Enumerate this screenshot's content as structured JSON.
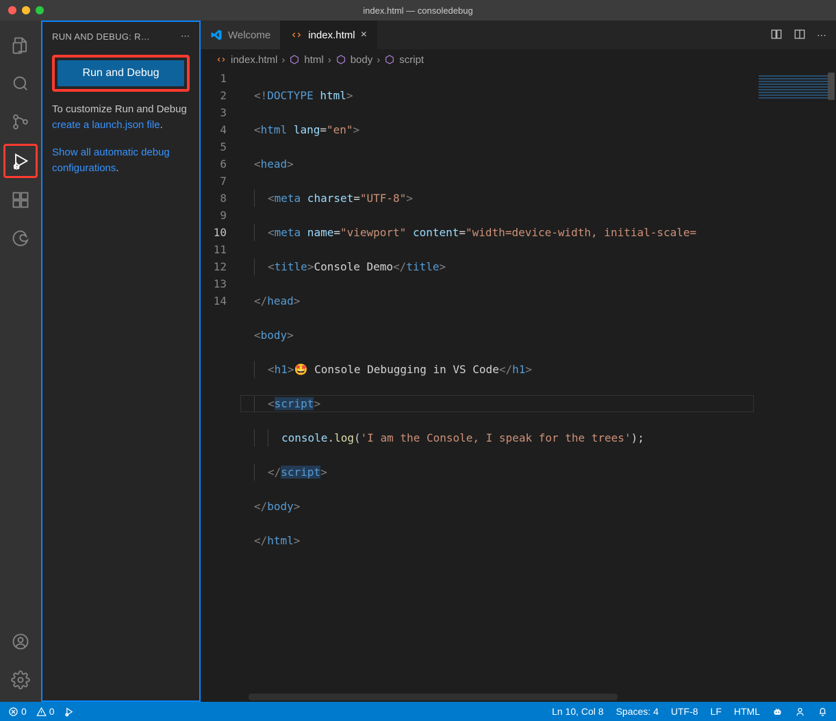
{
  "window": {
    "title": "index.html — consoledebug"
  },
  "sidebar": {
    "header": "RUN AND DEBUG: R…",
    "run_button": "Run and Debug",
    "customize_pre": "To customize Run and Debug ",
    "customize_link": "create a launch.json file",
    "customize_post": ".",
    "show_link": "Show all automatic debug configurations",
    "show_post": "."
  },
  "tabs": {
    "welcome": "Welcome",
    "file": "index.html"
  },
  "breadcrumbs": {
    "file": "index.html",
    "html": "html",
    "body": "body",
    "script": "script"
  },
  "code": {
    "l1a": "<!",
    "l1b": "DOCTYPE",
    "l1c": " html",
    "l1d": ">",
    "l2a": "<",
    "l2b": "html",
    "l2c": " lang",
    "l2d": "=",
    "l2e": "\"en\"",
    "l2f": ">",
    "l3a": "<",
    "l3b": "head",
    "l3c": ">",
    "l4a": "<",
    "l4b": "meta",
    "l4c": " charset",
    "l4d": "=",
    "l4e": "\"UTF-8\"",
    "l4f": ">",
    "l5a": "<",
    "l5b": "meta",
    "l5c": " name",
    "l5d": "=",
    "l5e": "\"viewport\"",
    "l5f": " content",
    "l5g": "=",
    "l5h": "\"width=device-width, initial-scale=",
    "l5z": "",
    "l6a": "<",
    "l6b": "title",
    "l6c": ">",
    "l6d": "Console Demo",
    "l6e": "</",
    "l6f": "title",
    "l6g": ">",
    "l7a": "</",
    "l7b": "head",
    "l7c": ">",
    "l8a": "<",
    "l8b": "body",
    "l8c": ">",
    "l9a": "<",
    "l9b": "h1",
    "l9c": ">",
    "l9d": "🤩 Console Debugging in VS Code",
    "l9e": "</",
    "l9f": "h1",
    "l9g": ">",
    "l10a": "<",
    "l10b": "script",
    "l10c": ">",
    "l11a": "console",
    "l11b": ".",
    "l11c": "log",
    "l11d": "(",
    "l11e": "'I am the Console, I speak for the trees'",
    "l11f": ");",
    "l12a": "</",
    "l12b": "script",
    "l12c": ">",
    "l13a": "</",
    "l13b": "body",
    "l13c": ">",
    "l14a": "</",
    "l14b": "html",
    "l14c": ">"
  },
  "status": {
    "errors": "0",
    "warnings": "0",
    "cursor": "Ln 10, Col 8",
    "spaces": "Spaces: 4",
    "encoding": "UTF-8",
    "eol": "LF",
    "lang": "HTML"
  }
}
